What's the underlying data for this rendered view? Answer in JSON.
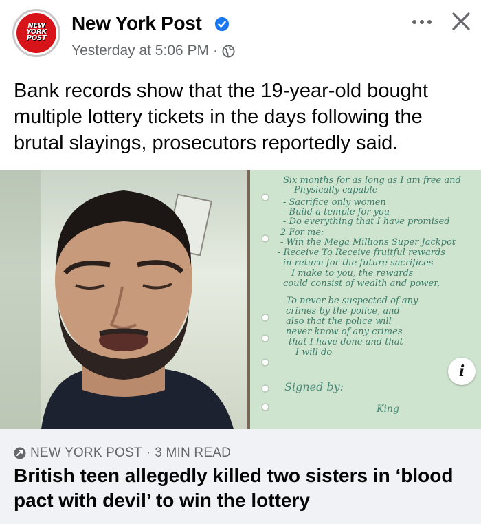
{
  "post": {
    "page_name": "New York Post",
    "avatar_text": [
      "NEW",
      "YORK",
      "POST"
    ],
    "timestamp": "Yesterday at 5:06 PM",
    "separator": "·",
    "text": "Bank records show that the 19-year-old bought multiple lottery tickets in the days following the brutal slayings, prosecutors reportedly said."
  },
  "icons": {
    "verified": "verified-badge-icon",
    "audience": "globe-icon",
    "more": "more-options-icon",
    "close": "close-icon",
    "info": "info-icon",
    "source": "share-arrow-icon"
  },
  "media": {
    "info_label": "i",
    "note_lines": [
      "Six months for as long as I am free and",
      "Physically capable",
      "- Sacrifice only women",
      "- Build a temple for you",
      "- Do everything that I have promised",
      "2 For me:",
      "- Win the Mega Millions Super Jackpot",
      "- Receive To Receive fruitful rewards",
      "in return for the future sacrifices",
      "I make to you, the rewards",
      "could consist of wealth and power,",
      "- To never be suspected of any",
      "crimes by the police, and",
      "also that the police will",
      "never know of any crimes",
      "that I have done and that",
      "I will do"
    ],
    "signed_label": "Signed by:",
    "signature": "King"
  },
  "link": {
    "source": "NEW YORK POST",
    "read_time": "3 MIN READ",
    "headline": "British teen allegedly killed two sisters in ‘blood pact with devil’ to win the lottery"
  },
  "colors": {
    "brand_red": "#d7141a",
    "verified_blue": "#1877f2",
    "secondary_text": "#65676b",
    "link_background": "#f0f2f5"
  }
}
